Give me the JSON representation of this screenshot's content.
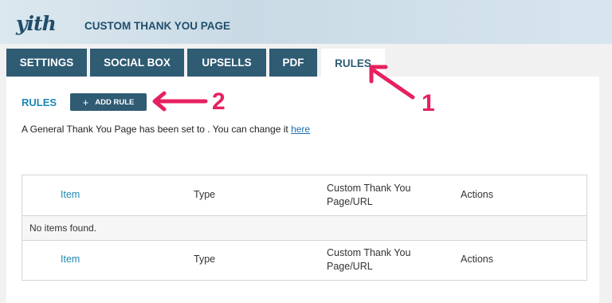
{
  "header": {
    "logo_text": "yith",
    "title": "CUSTOM THANK YOU PAGE"
  },
  "tabs": [
    {
      "label": "SETTINGS",
      "active": false
    },
    {
      "label": "SOCIAL BOX",
      "active": false
    },
    {
      "label": "UPSELLS",
      "active": false
    },
    {
      "label": "PDF",
      "active": false
    },
    {
      "label": "RULES",
      "active": true
    }
  ],
  "rules": {
    "title": "RULES",
    "add_button_label": "ADD RULE",
    "add_button_icon": "plus-icon",
    "notice_text": "A General Thank You Page has been set to . You can change it",
    "notice_link": "here"
  },
  "table": {
    "columns": [
      "Item",
      "Type",
      "Custom Thank You Page/URL",
      "Actions"
    ],
    "empty_message": "No items found."
  },
  "annotations": {
    "callout_1": "1",
    "callout_2": "2",
    "color": "#e6215f"
  },
  "colors": {
    "accent": "#2f5b73",
    "link": "#1e88b5"
  }
}
